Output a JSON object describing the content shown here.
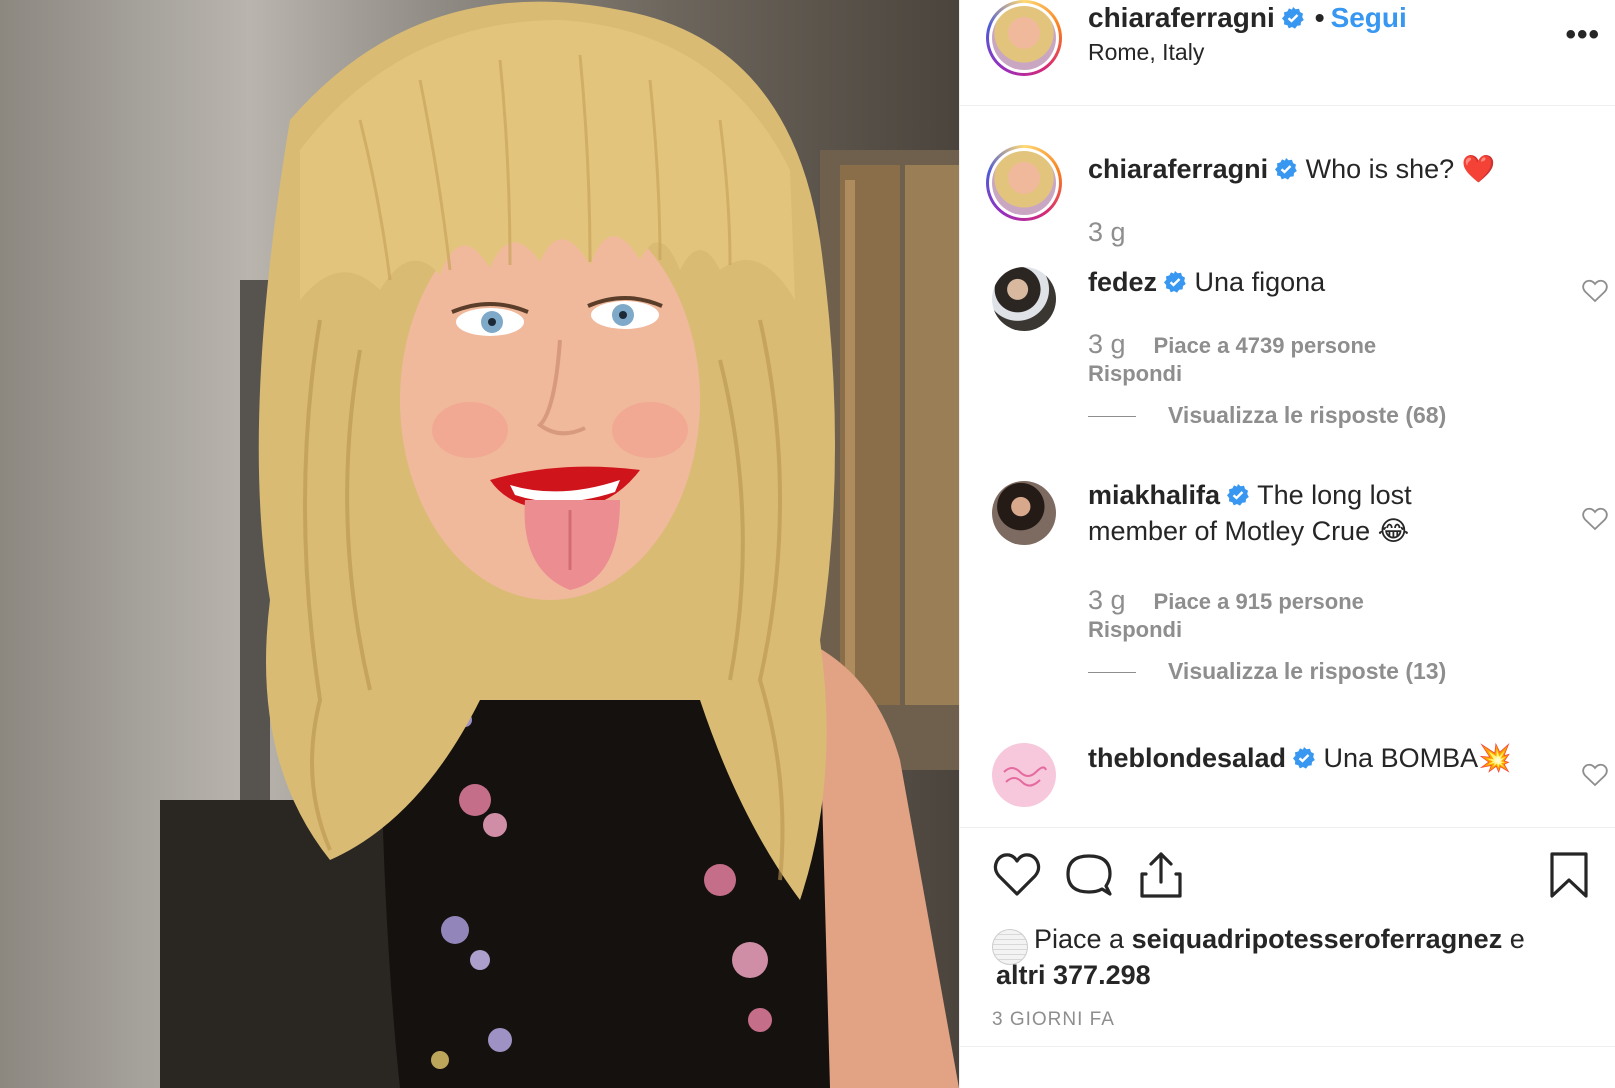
{
  "post": {
    "username": "chiaraferragni",
    "follow_label": "Segui",
    "location": "Rome, Italy",
    "more_label": "•••",
    "separator": "•"
  },
  "caption": {
    "username": "chiaraferragni",
    "text": "Who is she? ❤️",
    "time": "3 g"
  },
  "comments": [
    {
      "username": "fedez",
      "text": "Una figona",
      "time": "3 g",
      "likes": "Piace a 4739 persone",
      "reply": "Rispondi",
      "view_replies": "Visualizza le risposte (68)"
    },
    {
      "username": "miakhalifa",
      "text": "The long lost member of Motley Crue 😂",
      "time": "3 g",
      "likes": "Piace a 915 persone",
      "reply": "Rispondi",
      "view_replies": "Visualizza le risposte (13)"
    },
    {
      "username": "theblondesalad",
      "text": "Una BOMBA💥"
    }
  ],
  "likes_line": {
    "prefix": "Piace a",
    "user": "seiquadripotesseroferragnez",
    "suffix": "e",
    "others": "altri 377.298"
  },
  "date": "3 GIORNI FA",
  "colors": {
    "accent": "#3897f0",
    "text": "#262626",
    "muted": "#8e8e8e",
    "verified": "#3897f0"
  },
  "icons": [
    "heart-icon",
    "comment-icon",
    "share-icon",
    "bookmark-icon",
    "verified-icon",
    "more-icon"
  ]
}
